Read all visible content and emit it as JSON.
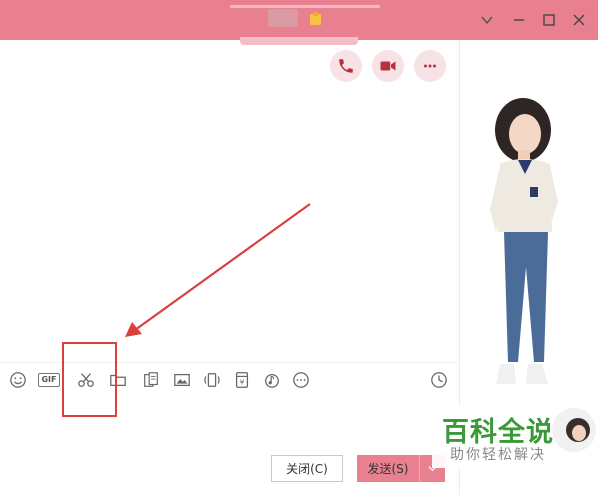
{
  "window": {
    "controls": [
      {
        "name": "dropdown",
        "icon": "chevron-down-icon"
      },
      {
        "name": "minimize",
        "icon": "minimize-icon"
      },
      {
        "name": "maximize",
        "icon": "maximize-icon"
      },
      {
        "name": "close",
        "icon": "close-icon"
      }
    ]
  },
  "header_actions": [
    {
      "name": "voice-call",
      "icon": "phone-icon"
    },
    {
      "name": "video-call",
      "icon": "video-camera-icon"
    },
    {
      "name": "more",
      "icon": "more-dots-icon"
    }
  ],
  "toolbar": {
    "gif_label": "GIF",
    "tools": [
      "emoji-icon",
      "gif-icon",
      "scissors-icon",
      "folder-icon",
      "doc-icon",
      "image-icon",
      "shake-icon",
      "red-packet-icon",
      "music-icon",
      "more-icon",
      "clock-icon"
    ],
    "red_packet_symbol": "¥"
  },
  "buttons": {
    "close_label": "关闭(C)",
    "send_label": "发送(S)"
  },
  "watermark": {
    "title": "百科全说",
    "subtitle": "助你轻松解决"
  },
  "colors": {
    "accent": "#e9808f",
    "icon_accent": "#b9303f",
    "annotation": "#d9403e",
    "watermark_green": "#3a9a3a"
  }
}
